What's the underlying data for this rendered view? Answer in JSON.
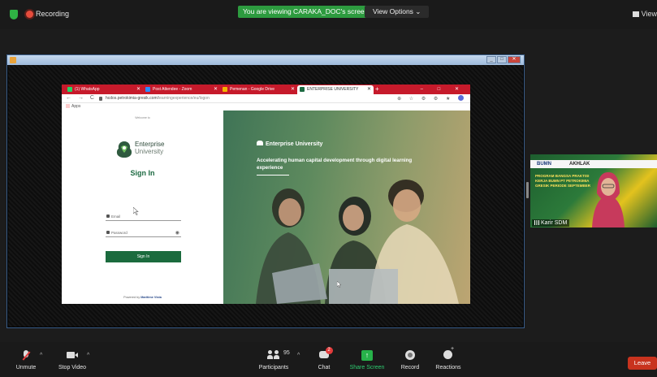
{
  "top_bar": {
    "recording_label": "Recording",
    "viewing_banner": "You are viewing CARAKA_DOC's screen",
    "view_options_label": "View Options ⌄",
    "view_label": "View"
  },
  "shared_window": {
    "window_controls": [
      "_",
      "□",
      "✕"
    ]
  },
  "browser": {
    "tabs": [
      {
        "label": "(1) WhatsApp",
        "icon_color": "#25d366"
      },
      {
        "label": "Post Attendee - Zoom",
        "icon_color": "#2d8cff"
      },
      {
        "label": "Pemenan - Google Drive",
        "icon_color": "#f4b400"
      },
      {
        "label": "ENTERPRISE UNIVERSITY",
        "icon_color": "#1d6a42"
      }
    ],
    "new_tab_label": "+",
    "window_controls": "– □ ✕",
    "nav_icons": "← → C",
    "url_host": "hcdos.petrokimia-gresik.com",
    "url_path": "/learningexperience/eu/logon",
    "addr_icons": "⊕ ☆ ⚙ ⚙ ★",
    "apps_label": "Apps"
  },
  "login": {
    "welcome_text": "Welcome to",
    "logo_line1": "Enterprise",
    "logo_line2": "University",
    "title": "Sign In",
    "email_placeholder": "Email",
    "password_placeholder": "Password",
    "eye_icon_glyph": "◉",
    "signin_button": "Sign In",
    "powered_prefix": "Powered by",
    "powered_brand": "Maritime Vista"
  },
  "hero": {
    "brand": "Enterprise University",
    "tagline": "Accelerating human capital development through digital learning experience"
  },
  "participant_video": {
    "name": "Karir SDM",
    "banner_left": "BUMN",
    "banner_mid": "AKHLAK",
    "promo_text": "PROGRAM BANGSA PRAKTISI KERJA BUMN PT PETROKIMIA GRESIK PERIODE SEPTEMBER"
  },
  "toolbar": {
    "unmute_label": "Unmute",
    "stop_video_label": "Stop Video",
    "participants_label": "Participants",
    "participants_count": "95",
    "chat_label": "Chat",
    "chat_badge": "2",
    "share_screen_label": "Share Screen",
    "record_label": "Record",
    "reactions_label": "Reactions",
    "leave_label": "Leave",
    "caret_glyph": "^"
  },
  "colors": {
    "share_green": "#2d9b3f",
    "leave_red": "#c8331e",
    "brand_green": "#1b6b3e",
    "chrome_red": "#c61a2b"
  }
}
